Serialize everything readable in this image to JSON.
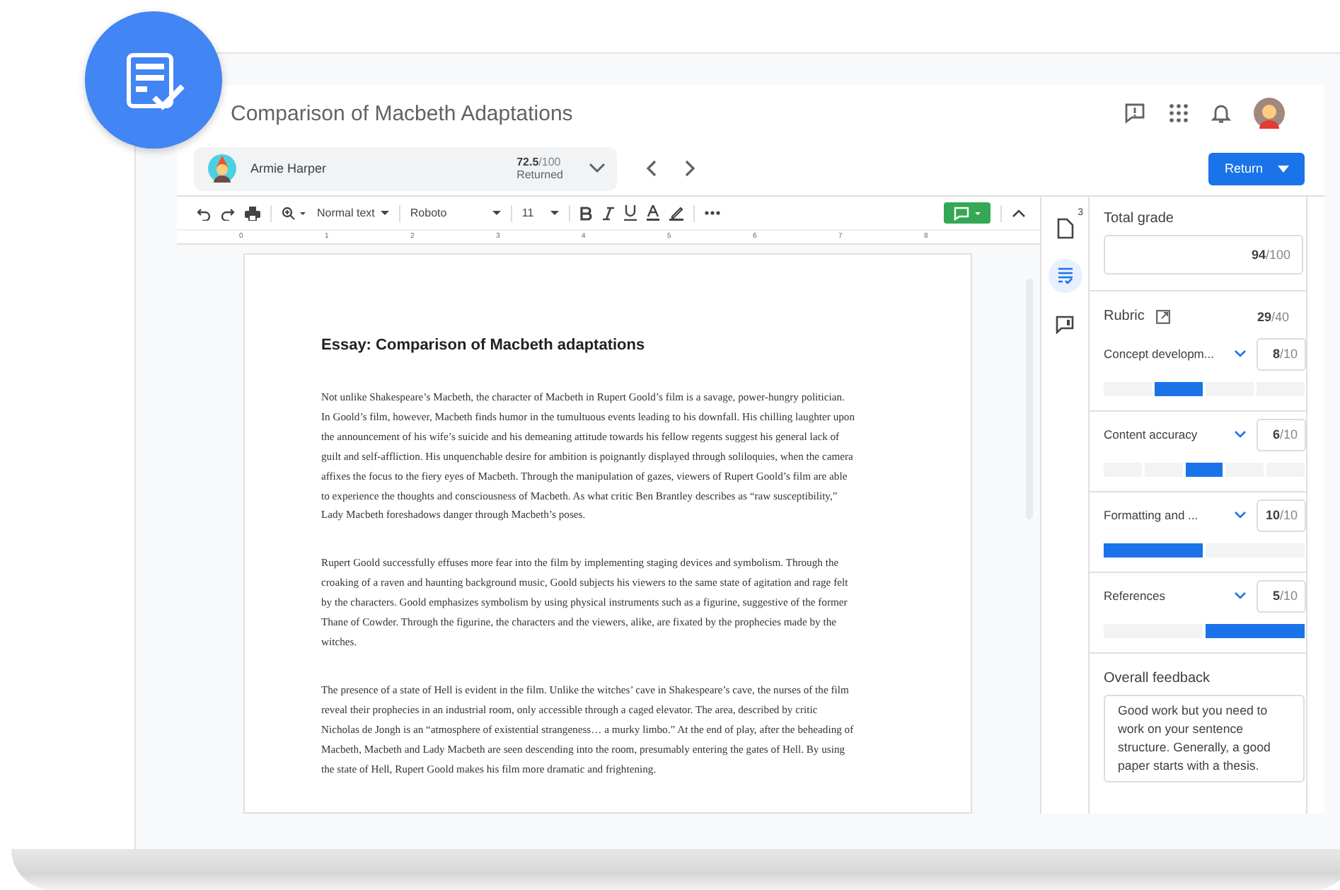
{
  "window": {
    "title": "Comparison of Macbeth Adaptations"
  },
  "student": {
    "name": "Armie Harper",
    "grade": "**72.5**/100",
    "status": "Returned"
  },
  "return_button": {
    "label": "Return"
  },
  "toolbar": {
    "style": "Normal text",
    "font": "Roboto",
    "size": "11"
  },
  "ruler": {
    "marks": [
      "0",
      "1",
      "2",
      "3",
      "4",
      "5",
      "6",
      "7",
      "8"
    ]
  },
  "document": {
    "heading": "Essay: Comparison of Macbeth adaptations",
    "paragraphs": [
      "Not unlike Shakespeare’s Macbeth, the character of Macbeth in Rupert Goold’s film is a savage, power-hungry politician. In Goold’s film, however, Macbeth finds humor in the tumultuous events leading to his downfall. His chilling laughter upon the announcement of his wife’s suicide and his demeaning attitude towards his fellow regents suggest his general lack of guilt and self-affliction. His unquenchable desire for ambition is poignantly displayed through soliloquies, when the camera affixes the focus to the fiery eyes of Macbeth. Through the manipulation of gazes, viewers of Rupert Goold’s film are able to experience the thoughts and consciousness of Macbeth. As what critic Ben Brantley describes as “raw susceptibility,” Lady Macbeth foreshadows danger through Macbeth’s poses.",
      "Rupert Goold successfully effuses more fear into the film by implementing staging devices and symbolism. Through the croaking of a raven and haunting background music, Goold subjects his viewers to the same state of agitation and rage felt by the characters. Goold emphasizes symbolism by using physical instruments such as a figurine, suggestive of the former Thane of Cowder. Through the figurine, the characters and the viewers, alike, are fixated by the prophecies made by the witches.",
      "The presence of a state of Hell is evident in the film. Unlike the witches’ cave in Shakespeare’s cave, the nurses of the film reveal their prophecies in an industrial room, only accessible through a caged elevator. The area, described by critic Nicholas de Jongh is an “atmosphere of existential strangeness… a murky limbo.” At the end of play, after the beheading of Macbeth, Macbeth and Lady Macbeth are seen descending into the room, presumably entering the gates of Hell. By using the state of Hell, Rupert Goold makes his film more dramatic and frightening."
    ]
  },
  "side_tabs": [
    {
      "kind": "files",
      "badge": "3",
      "selected": false
    },
    {
      "kind": "rubric",
      "selected": true
    },
    {
      "kind": "comments",
      "selected": false
    }
  ],
  "total_grade": {
    "label": "Total grade",
    "value": "**94**/100"
  },
  "rubric": {
    "title": "Rubric",
    "score": "**29**/40",
    "criteria": [
      {
        "name": "Concept developm...",
        "score": "**8**/10",
        "levels": [
          {
            "selected": false
          },
          {
            "selected": true
          },
          {
            "selected": false
          },
          {
            "selected": false
          }
        ]
      },
      {
        "name": "Content accuracy",
        "score": "**6**/10",
        "levels": [
          {
            "selected": false
          },
          {
            "selected": false
          },
          {
            "selected": true
          },
          {
            "selected": false
          },
          {
            "selected": false
          }
        ]
      },
      {
        "name": "Formatting and ...",
        "score": "**10**/10",
        "levels": [
          {
            "selected": true
          },
          {
            "selected": false
          }
        ]
      },
      {
        "name": "References",
        "score": "**5**/10",
        "levels": [
          {
            "selected": false
          },
          {
            "selected": true
          }
        ]
      }
    ]
  },
  "overall_feedback": {
    "label": "Overall feedback",
    "value": "Good work but you need to work on your sentence structure. Generally, a good paper starts with a thesis."
  }
}
